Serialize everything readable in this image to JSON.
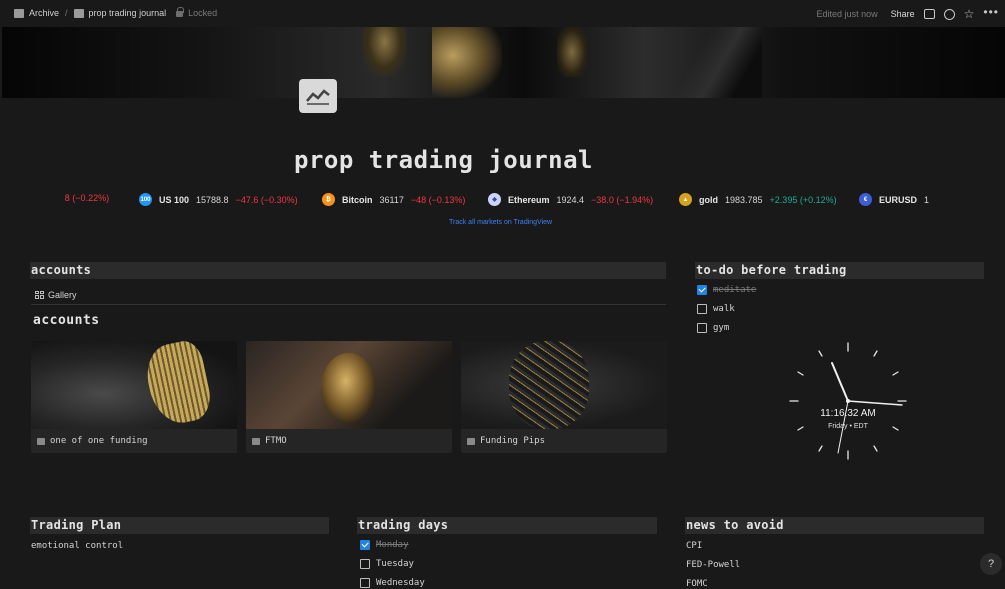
{
  "breadcrumb": {
    "root": "Archive",
    "separator": "/",
    "page": "prop trading journal",
    "lock_label": "Locked"
  },
  "topbar": {
    "edited": "Edited just now",
    "share": "Share"
  },
  "page": {
    "title": "prop trading journal"
  },
  "ticker": {
    "items": [
      {
        "symbol": "",
        "price": "",
        "change": " 8 (−0.22%)",
        "dir": "neg",
        "icon": "",
        "color": ""
      },
      {
        "symbol": "US 100",
        "price": "15788.8",
        "change": "−47.6 (−0.30%)",
        "dir": "neg",
        "icon": "100",
        "color": "#2196f3"
      },
      {
        "symbol": "Bitcoin",
        "price": "36117",
        "change": "−48 (−0.13%)",
        "dir": "neg",
        "icon": "₿",
        "color": "#f7931a"
      },
      {
        "symbol": "Ethereum",
        "price": "1924.4",
        "change": "−38.0 (−1.94%)",
        "dir": "neg",
        "icon": "◆",
        "color": "#c9d4ff"
      },
      {
        "symbol": "gold",
        "price": "1983.785",
        "change": "+2.395 (+0.12%)",
        "dir": "pos",
        "icon": "▲",
        "color": "#d6a21e"
      },
      {
        "symbol": "EURUSD",
        "price": "1",
        "change": "",
        "dir": "neg",
        "icon": "€",
        "color": "#3c5fd6"
      }
    ],
    "link": "Track all markets on TradingView"
  },
  "accounts": {
    "header": "accounts",
    "tab": "Gallery",
    "title": "accounts",
    "cards": [
      {
        "label": "one of one funding"
      },
      {
        "label": "FTMO"
      },
      {
        "label": "Funding Pips"
      }
    ]
  },
  "todo": {
    "header": "to-do before trading",
    "items": [
      {
        "label": "meditate",
        "checked": true
      },
      {
        "label": "walk",
        "checked": false
      },
      {
        "label": "gym",
        "checked": false
      }
    ]
  },
  "clock": {
    "time": "11:16:32 AM",
    "date": "Friday • EDT"
  },
  "trading_plan": {
    "header": "Trading Plan",
    "items": [
      "emotional control"
    ]
  },
  "trading_days": {
    "header": "trading days",
    "items": [
      {
        "label": "Monday",
        "checked": true
      },
      {
        "label": "Tuesday",
        "checked": false
      },
      {
        "label": "Wednesday",
        "checked": false
      }
    ]
  },
  "news": {
    "header": "news to avoid",
    "items": [
      "CPI",
      "FED-Powell",
      "FOMC"
    ]
  },
  "help": {
    "label": "?"
  }
}
